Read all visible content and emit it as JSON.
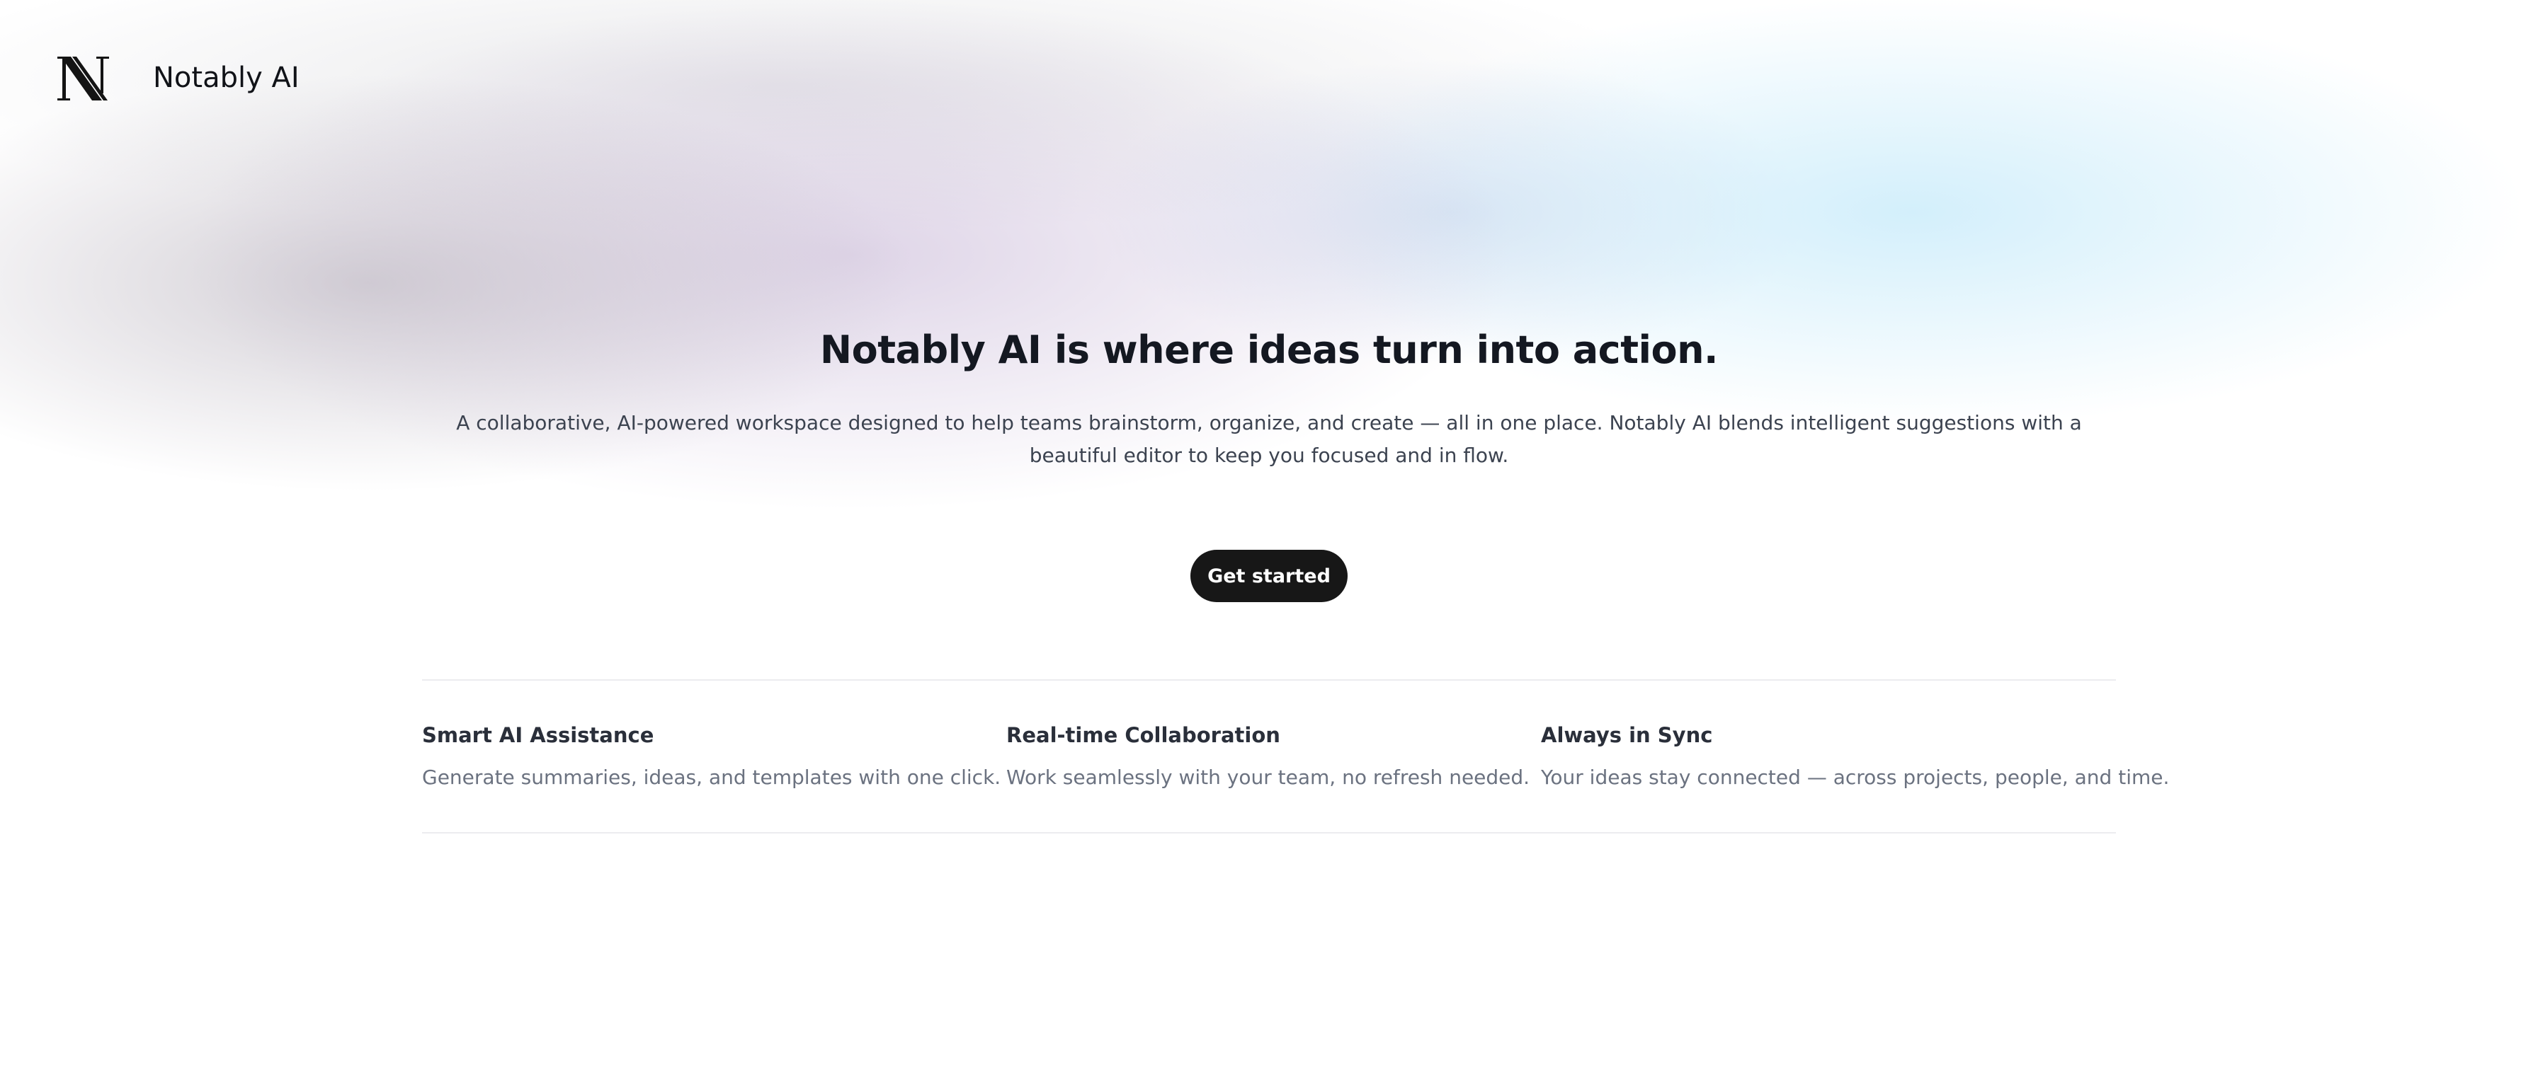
{
  "brand": {
    "logo_icon": "notably-n-logo-icon",
    "name": "Notably AI"
  },
  "hero": {
    "title": "Notably AI is where ideas turn into action.",
    "subtitle": "A collaborative, AI-powered workspace designed to help teams brainstorm, organize, and create — all in one place. Notably AI blends intelligent suggestions with a beautiful editor to keep you focused and in flow.",
    "cta_label": "Get started"
  },
  "features": [
    {
      "title": "Smart AI Assistance",
      "description": "Generate summaries, ideas, and templates with one click."
    },
    {
      "title": "Real-time Collaboration",
      "description": "Work seamlessly with your team, no refresh needed."
    },
    {
      "title": "Always in Sync",
      "description": "Your ideas stay connected — across projects, people, and time."
    }
  ],
  "colors": {
    "text_primary": "#141821",
    "text_secondary": "#3c4350",
    "text_muted": "#6b7280",
    "button_bg": "#171717",
    "button_text": "#ffffff",
    "divider": "#ececef"
  }
}
